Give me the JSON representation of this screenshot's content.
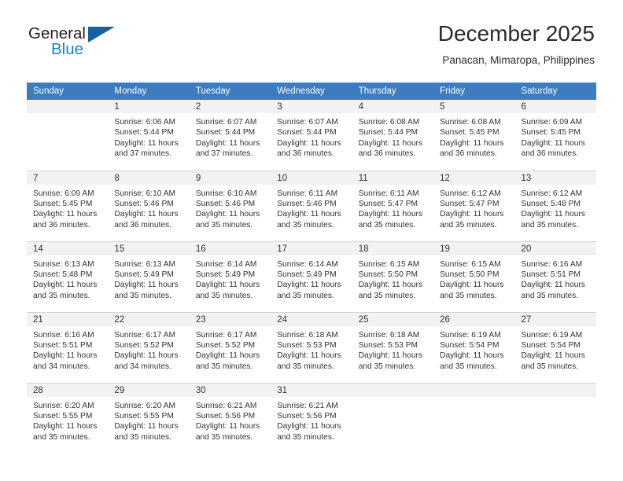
{
  "brand": {
    "name_top": "General",
    "name_bottom": "Blue",
    "accent_color": "#1463a0",
    "blue_text_color": "#1a7fc1"
  },
  "header": {
    "title": "December 2025",
    "subtitle": "Panacan, Mimaropa, Philippines"
  },
  "theme": {
    "header_row_bg": "#3d7cbf",
    "daynum_bg": "#f2f2f2",
    "grid_line": "#d4d4d4",
    "text": "#333333"
  },
  "labels": {
    "sunrise": "Sunrise:",
    "sunset": "Sunset:",
    "daylight": "Daylight:"
  },
  "weekdays": [
    "Sunday",
    "Monday",
    "Tuesday",
    "Wednesday",
    "Thursday",
    "Friday",
    "Saturday"
  ],
  "weeks": [
    [
      {
        "day": "",
        "blank": true,
        "sunrise": "",
        "sunset": "",
        "daylight_1": "",
        "daylight_2": ""
      },
      {
        "day": "1",
        "sunrise": "Sunrise: 6:06 AM",
        "sunset": "Sunset: 5:44 PM",
        "daylight_1": "Daylight: 11 hours",
        "daylight_2": "and 37 minutes."
      },
      {
        "day": "2",
        "sunrise": "Sunrise: 6:07 AM",
        "sunset": "Sunset: 5:44 PM",
        "daylight_1": "Daylight: 11 hours",
        "daylight_2": "and 37 minutes."
      },
      {
        "day": "3",
        "sunrise": "Sunrise: 6:07 AM",
        "sunset": "Sunset: 5:44 PM",
        "daylight_1": "Daylight: 11 hours",
        "daylight_2": "and 36 minutes."
      },
      {
        "day": "4",
        "sunrise": "Sunrise: 6:08 AM",
        "sunset": "Sunset: 5:44 PM",
        "daylight_1": "Daylight: 11 hours",
        "daylight_2": "and 36 minutes."
      },
      {
        "day": "5",
        "sunrise": "Sunrise: 6:08 AM",
        "sunset": "Sunset: 5:45 PM",
        "daylight_1": "Daylight: 11 hours",
        "daylight_2": "and 36 minutes."
      },
      {
        "day": "6",
        "sunrise": "Sunrise: 6:09 AM",
        "sunset": "Sunset: 5:45 PM",
        "daylight_1": "Daylight: 11 hours",
        "daylight_2": "and 36 minutes."
      }
    ],
    [
      {
        "day": "7",
        "sunrise": "Sunrise: 6:09 AM",
        "sunset": "Sunset: 5:45 PM",
        "daylight_1": "Daylight: 11 hours",
        "daylight_2": "and 36 minutes."
      },
      {
        "day": "8",
        "sunrise": "Sunrise: 6:10 AM",
        "sunset": "Sunset: 5:46 PM",
        "daylight_1": "Daylight: 11 hours",
        "daylight_2": "and 36 minutes."
      },
      {
        "day": "9",
        "sunrise": "Sunrise: 6:10 AM",
        "sunset": "Sunset: 5:46 PM",
        "daylight_1": "Daylight: 11 hours",
        "daylight_2": "and 35 minutes."
      },
      {
        "day": "10",
        "sunrise": "Sunrise: 6:11 AM",
        "sunset": "Sunset: 5:46 PM",
        "daylight_1": "Daylight: 11 hours",
        "daylight_2": "and 35 minutes."
      },
      {
        "day": "11",
        "sunrise": "Sunrise: 6:11 AM",
        "sunset": "Sunset: 5:47 PM",
        "daylight_1": "Daylight: 11 hours",
        "daylight_2": "and 35 minutes."
      },
      {
        "day": "12",
        "sunrise": "Sunrise: 6:12 AM",
        "sunset": "Sunset: 5:47 PM",
        "daylight_1": "Daylight: 11 hours",
        "daylight_2": "and 35 minutes."
      },
      {
        "day": "13",
        "sunrise": "Sunrise: 6:12 AM",
        "sunset": "Sunset: 5:48 PM",
        "daylight_1": "Daylight: 11 hours",
        "daylight_2": "and 35 minutes."
      }
    ],
    [
      {
        "day": "14",
        "sunrise": "Sunrise: 6:13 AM",
        "sunset": "Sunset: 5:48 PM",
        "daylight_1": "Daylight: 11 hours",
        "daylight_2": "and 35 minutes."
      },
      {
        "day": "15",
        "sunrise": "Sunrise: 6:13 AM",
        "sunset": "Sunset: 5:49 PM",
        "daylight_1": "Daylight: 11 hours",
        "daylight_2": "and 35 minutes."
      },
      {
        "day": "16",
        "sunrise": "Sunrise: 6:14 AM",
        "sunset": "Sunset: 5:49 PM",
        "daylight_1": "Daylight: 11 hours",
        "daylight_2": "and 35 minutes."
      },
      {
        "day": "17",
        "sunrise": "Sunrise: 6:14 AM",
        "sunset": "Sunset: 5:49 PM",
        "daylight_1": "Daylight: 11 hours",
        "daylight_2": "and 35 minutes."
      },
      {
        "day": "18",
        "sunrise": "Sunrise: 6:15 AM",
        "sunset": "Sunset: 5:50 PM",
        "daylight_1": "Daylight: 11 hours",
        "daylight_2": "and 35 minutes."
      },
      {
        "day": "19",
        "sunrise": "Sunrise: 6:15 AM",
        "sunset": "Sunset: 5:50 PM",
        "daylight_1": "Daylight: 11 hours",
        "daylight_2": "and 35 minutes."
      },
      {
        "day": "20",
        "sunrise": "Sunrise: 6:16 AM",
        "sunset": "Sunset: 5:51 PM",
        "daylight_1": "Daylight: 11 hours",
        "daylight_2": "and 35 minutes."
      }
    ],
    [
      {
        "day": "21",
        "sunrise": "Sunrise: 6:16 AM",
        "sunset": "Sunset: 5:51 PM",
        "daylight_1": "Daylight: 11 hours",
        "daylight_2": "and 34 minutes."
      },
      {
        "day": "22",
        "sunrise": "Sunrise: 6:17 AM",
        "sunset": "Sunset: 5:52 PM",
        "daylight_1": "Daylight: 11 hours",
        "daylight_2": "and 34 minutes."
      },
      {
        "day": "23",
        "sunrise": "Sunrise: 6:17 AM",
        "sunset": "Sunset: 5:52 PM",
        "daylight_1": "Daylight: 11 hours",
        "daylight_2": "and 35 minutes."
      },
      {
        "day": "24",
        "sunrise": "Sunrise: 6:18 AM",
        "sunset": "Sunset: 5:53 PM",
        "daylight_1": "Daylight: 11 hours",
        "daylight_2": "and 35 minutes."
      },
      {
        "day": "25",
        "sunrise": "Sunrise: 6:18 AM",
        "sunset": "Sunset: 5:53 PM",
        "daylight_1": "Daylight: 11 hours",
        "daylight_2": "and 35 minutes."
      },
      {
        "day": "26",
        "sunrise": "Sunrise: 6:19 AM",
        "sunset": "Sunset: 5:54 PM",
        "daylight_1": "Daylight: 11 hours",
        "daylight_2": "and 35 minutes."
      },
      {
        "day": "27",
        "sunrise": "Sunrise: 6:19 AM",
        "sunset": "Sunset: 5:54 PM",
        "daylight_1": "Daylight: 11 hours",
        "daylight_2": "and 35 minutes."
      }
    ],
    [
      {
        "day": "28",
        "sunrise": "Sunrise: 6:20 AM",
        "sunset": "Sunset: 5:55 PM",
        "daylight_1": "Daylight: 11 hours",
        "daylight_2": "and 35 minutes."
      },
      {
        "day": "29",
        "sunrise": "Sunrise: 6:20 AM",
        "sunset": "Sunset: 5:55 PM",
        "daylight_1": "Daylight: 11 hours",
        "daylight_2": "and 35 minutes."
      },
      {
        "day": "30",
        "sunrise": "Sunrise: 6:21 AM",
        "sunset": "Sunset: 5:56 PM",
        "daylight_1": "Daylight: 11 hours",
        "daylight_2": "and 35 minutes."
      },
      {
        "day": "31",
        "sunrise": "Sunrise: 6:21 AM",
        "sunset": "Sunset: 5:56 PM",
        "daylight_1": "Daylight: 11 hours",
        "daylight_2": "and 35 minutes."
      },
      {
        "day": "",
        "blank": true,
        "sunrise": "",
        "sunset": "",
        "daylight_1": "",
        "daylight_2": ""
      },
      {
        "day": "",
        "blank": true,
        "sunrise": "",
        "sunset": "",
        "daylight_1": "",
        "daylight_2": ""
      },
      {
        "day": "",
        "blank": true,
        "sunrise": "",
        "sunset": "",
        "daylight_1": "",
        "daylight_2": ""
      }
    ]
  ]
}
